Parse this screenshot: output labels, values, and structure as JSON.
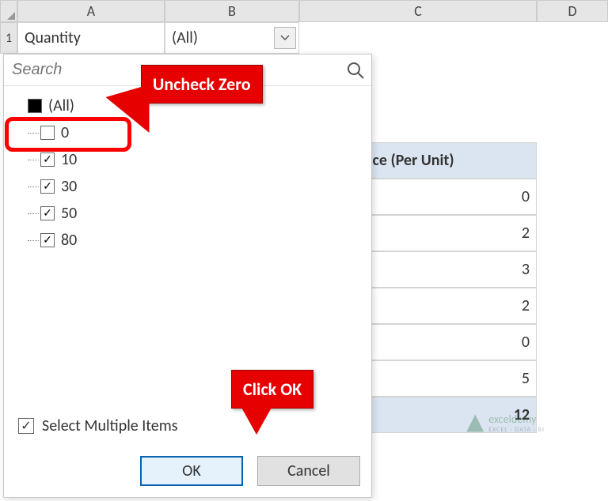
{
  "columns": {
    "A": "A",
    "B": "B",
    "C": "C",
    "D": "D"
  },
  "rows": {
    "r1": "1"
  },
  "pivot": {
    "field_label": "Quantity",
    "field_value": "(All)",
    "col_header_right": "f Price (Per Unit)",
    "values": [
      "0",
      "2",
      "3",
      "2",
      "0",
      "5"
    ],
    "grand_total": "12"
  },
  "dropdown": {
    "search_placeholder": "Search",
    "items": [
      {
        "label": "(All)",
        "state": "mixed"
      },
      {
        "label": "0",
        "state": "unchecked"
      },
      {
        "label": "10",
        "state": "checked"
      },
      {
        "label": "30",
        "state": "checked"
      },
      {
        "label": "50",
        "state": "checked"
      },
      {
        "label": "80",
        "state": "checked"
      }
    ],
    "select_multi": "Select Multiple Items",
    "ok": "OK",
    "cancel": "Cancel"
  },
  "callouts": {
    "uncheck": "Uncheck Zero",
    "clickok": "Click OK"
  },
  "watermark": {
    "brand": "exceldemy",
    "sub": "EXCEL · DATA · BI"
  }
}
